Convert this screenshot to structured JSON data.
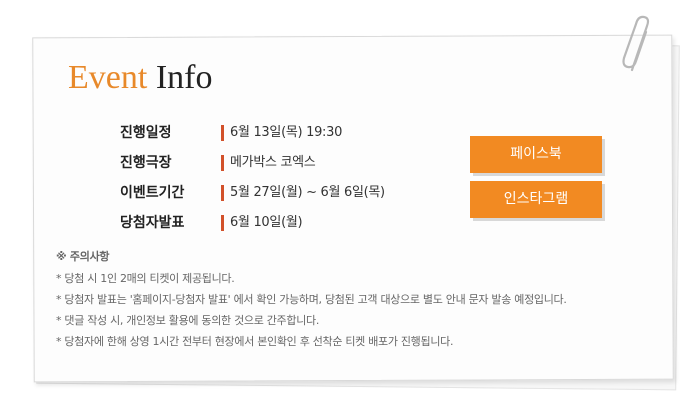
{
  "title": {
    "accent": "Event",
    "rest": "Info"
  },
  "info_rows": [
    {
      "label": "진행일정",
      "value": "6월 13일(목) 19:30"
    },
    {
      "label": "진행극장",
      "value": "메가박스 코엑스"
    },
    {
      "label": "이벤트기간",
      "value": "5월 27일(월) ~ 6월 6일(목)"
    },
    {
      "label": "당첨자발표",
      "value": "6월 10일(월)"
    }
  ],
  "buttons": {
    "facebook": "페이스북",
    "instagram": "인스타그램"
  },
  "notes": {
    "heading": "※ 주의사항",
    "lines": [
      "* 당첨 시 1인 2매의 티켓이 제공됩니다.",
      "* 당첨자 발표는 '홈페이지-당첨자 발표' 에서 확인 가능하며, 당첨된 고객 대상으로 별도 안내 문자 발송 예정입니다.",
      "* 댓글 작성 시, 개인정보 활용에 동의한 것으로 간주합니다.",
      "* 당첨자에 한해 상영 1시간 전부터 현장에서 본인확인 후 선착순 티켓 배포가 진행됩니다."
    ]
  },
  "colors": {
    "accent_orange": "#e8892a",
    "button_orange": "#f28a22",
    "separator_red": "#d2512a"
  },
  "icons": {
    "clip": "paperclip-icon"
  }
}
